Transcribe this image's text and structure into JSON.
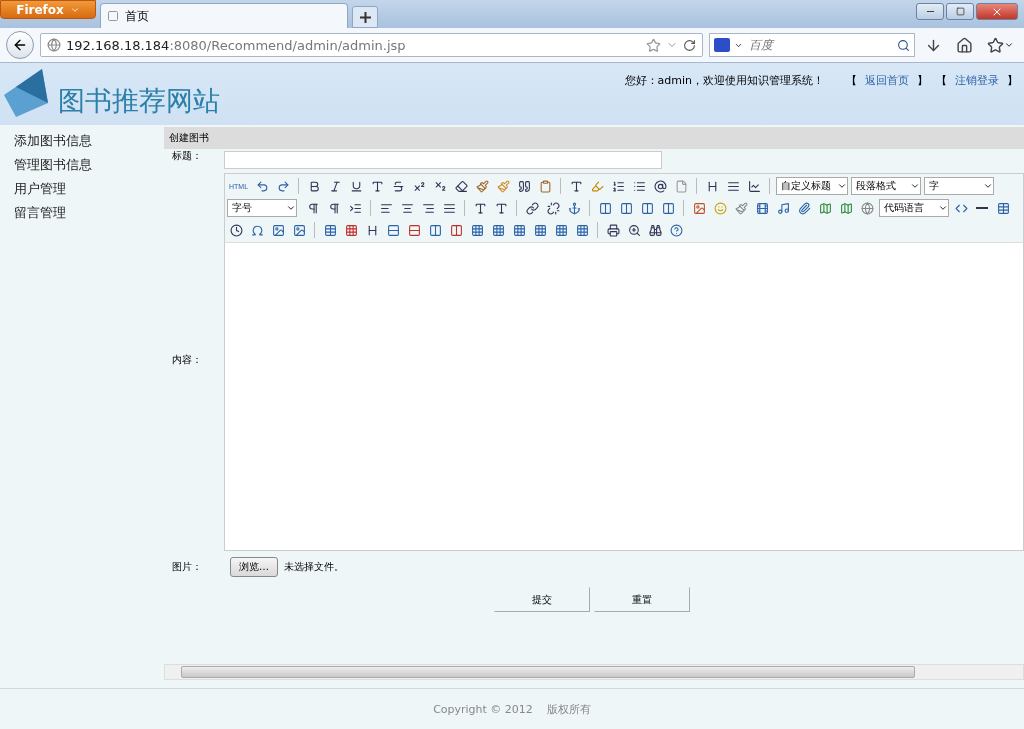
{
  "browser": {
    "app_button": "Firefox",
    "tab_title": "首页",
    "url_host": "192.168.18.184",
    "url_rest": ":8080/Recommend/admin/admin.jsp",
    "search_placeholder": "百度"
  },
  "header": {
    "site_title": "图书推荐网站",
    "greeting": "您好：admin，欢迎使用知识管理系统！",
    "links": [
      {
        "open": "【",
        "label": "返回首页",
        "close": "】"
      },
      {
        "open": "【",
        "label": "注销登录",
        "close": "】"
      }
    ]
  },
  "sidebar": {
    "items": [
      {
        "label": "添加图书信息"
      },
      {
        "label": "管理图书信息"
      },
      {
        "label": "用户管理"
      },
      {
        "label": "留言管理"
      }
    ]
  },
  "panel_title": "创建图书",
  "form": {
    "title_label": "标题：",
    "content_label": "内容：",
    "image_label": "图片：",
    "browse_button": "浏览…",
    "no_file": "未选择文件。",
    "buttons": [
      "提交",
      "重置"
    ]
  },
  "editor": {
    "html_label": "HTML",
    "row_1_selects": [
      "自定义标题",
      "段落格式",
      "字"
    ],
    "row_2_selects": [
      "字号",
      "代码语言"
    ]
  },
  "footer": "Copyright © 2012    版权所有"
}
